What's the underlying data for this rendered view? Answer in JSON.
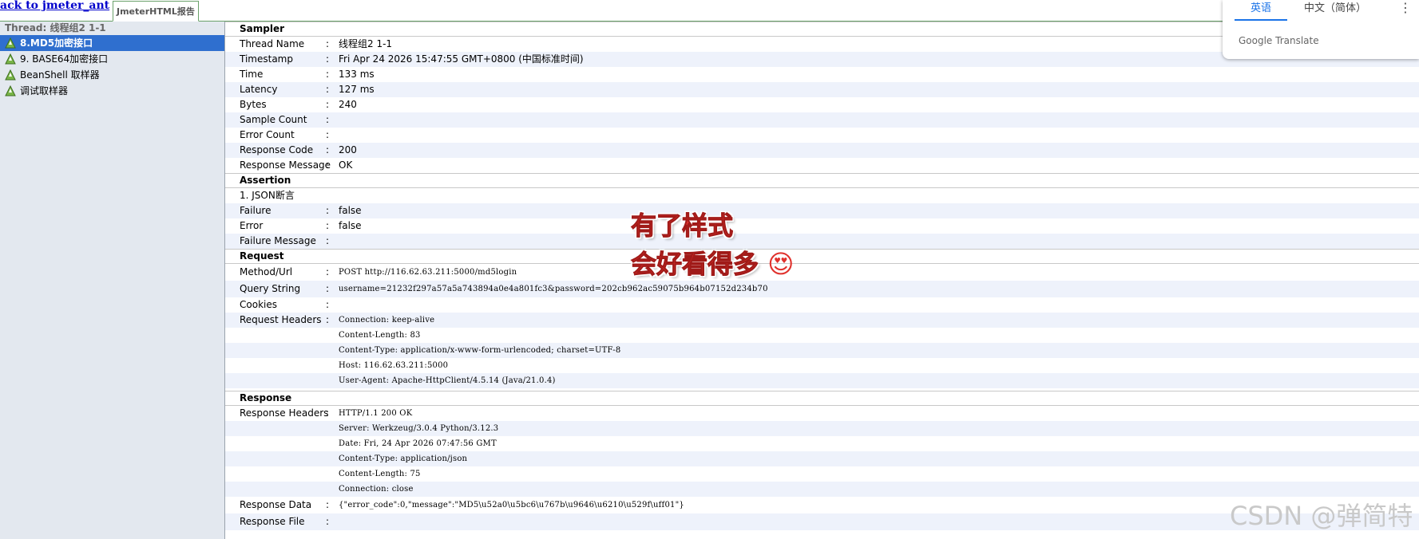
{
  "topbar": {
    "back_link": "ack to jmeter_ant",
    "report_tab": "JmeterHTML报告"
  },
  "sidebar": {
    "thread_title": "Thread: 线程组2 1-1",
    "items": [
      {
        "label": "8.MD5加密接口",
        "selected": true
      },
      {
        "label": "9. BASE64加密接口",
        "selected": false
      },
      {
        "label": "BeanShell 取样器",
        "selected": false
      },
      {
        "label": "调试取样器",
        "selected": false
      }
    ]
  },
  "sampler": {
    "title": "Sampler",
    "rows": [
      {
        "label": "Thread Name",
        "value": "线程组2 1-1"
      },
      {
        "label": "Timestamp",
        "value": "Fri Apr 24 2026 15:47:55 GMT+0800 (中国标准时间)"
      },
      {
        "label": "Time",
        "value": "133 ms"
      },
      {
        "label": "Latency",
        "value": "127 ms"
      },
      {
        "label": "Bytes",
        "value": "240"
      },
      {
        "label": "Sample Count",
        "value": ""
      },
      {
        "label": "Error Count",
        "value": ""
      },
      {
        "label": "Response Code",
        "value": "200"
      },
      {
        "label": "Response Message",
        "value": "OK"
      }
    ]
  },
  "assertion": {
    "title": "Assertion",
    "name": "1. JSON断言",
    "rows": [
      {
        "label": "Failure",
        "value": "false"
      },
      {
        "label": "Error",
        "value": "false"
      },
      {
        "label": "Failure Message",
        "value": ""
      }
    ]
  },
  "request": {
    "title": "Request",
    "method_url_label": "Method/Url",
    "method_url": "POST http://116.62.63.211:5000/md5login",
    "query_label": "Query String",
    "query": "username=21232f297a57a5a743894a0e4a801fc3&password=202cb962ac59075b964b07152d234b70",
    "cookies_label": "Cookies",
    "cookies": "",
    "headers_label": "Request Headers",
    "headers": [
      "Connection: keep-alive",
      "Content-Length: 83",
      "Content-Type: application/x-www-form-urlencoded; charset=UTF-8",
      "Host: 116.62.63.211:5000",
      "User-Agent: Apache-HttpClient/4.5.14 (Java/21.0.4)"
    ]
  },
  "response": {
    "title": "Response",
    "headers_label": "Response Headers",
    "headers": [
      "HTTP/1.1 200 OK",
      "Server: Werkzeug/3.0.4 Python/3.12.3",
      "Date: Fri, 24 Apr 2026 07:47:56 GMT",
      "Content-Type: application/json",
      "Content-Length: 75",
      "Connection: close"
    ],
    "data_label": "Response Data",
    "data": "{\"error_code\":0,\"message\":\"MD5\\u52a0\\u5bc6\\u767b\\u9646\\u6210\\u529f\\uff01\"}",
    "file_label": "Response File",
    "file": ""
  },
  "translate": {
    "tab_active": "英语",
    "tab_other": "中文（简体）",
    "menu": "⋮",
    "brand": "Google Translate"
  },
  "annotation": {
    "line1": "有了样式",
    "line2": "会好看得多",
    "emoji": "😍"
  },
  "watermark": "CSDN @弹简特",
  "colors": {
    "selected": "#2f6fcf",
    "link": "#0000cc",
    "alt_row": "#eef2fb",
    "sidebar_bg": "#e3e8ef",
    "annotation": "#e0322d"
  }
}
